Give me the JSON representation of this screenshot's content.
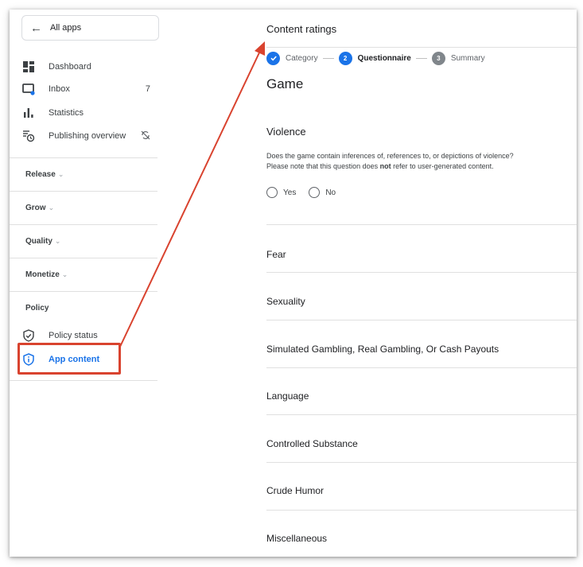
{
  "sidebar": {
    "all_apps": "All apps",
    "items": [
      {
        "label": "Dashboard"
      },
      {
        "label": "Inbox",
        "count": "7"
      },
      {
        "label": "Statistics"
      },
      {
        "label": "Publishing overview"
      }
    ],
    "sections": [
      "Release",
      "Grow",
      "Quality",
      "Monetize"
    ],
    "policy": {
      "heading": "Policy",
      "items": [
        {
          "label": "Policy status"
        },
        {
          "label": "App content"
        }
      ]
    }
  },
  "main": {
    "title": "Content ratings",
    "steps": [
      {
        "label": "Category",
        "state": "done",
        "number": ""
      },
      {
        "label": "Questionnaire",
        "state": "current",
        "number": "2"
      },
      {
        "label": "Summary",
        "state": "todo",
        "number": "3"
      }
    ],
    "game_heading": "Game",
    "violence": {
      "title": "Violence",
      "question_line1": "Does the game contain inferences of, references to, or depictions of violence?",
      "question_line2_pre": "Please note that this question does ",
      "question_line2_bold": "not",
      "question_line2_post": " refer to user-generated content.",
      "options": [
        "Yes",
        "No"
      ]
    },
    "categories": [
      "Fear",
      "Sexuality",
      "Simulated Gambling, Real Gambling, Or Cash Payouts",
      "Language",
      "Controlled Substance",
      "Crude Humor",
      "Miscellaneous"
    ]
  },
  "colors": {
    "accent": "#1a73e8",
    "annotation": "#d9432f"
  }
}
